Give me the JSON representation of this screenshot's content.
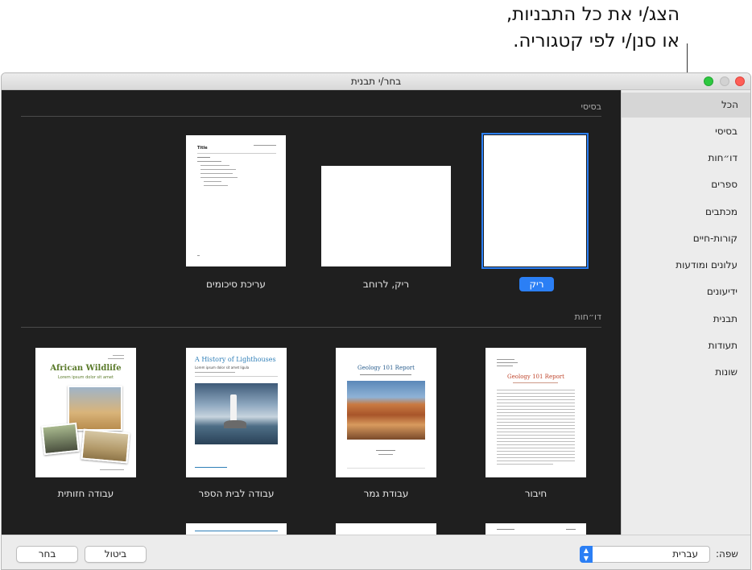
{
  "callout": {
    "line1": "הצג/י את כל התבניות,",
    "line2": "או סנן/י לפי קטגוריה."
  },
  "window": {
    "title": "בחר/י תבנית"
  },
  "sidebar": {
    "items": [
      {
        "label": "הכל"
      },
      {
        "label": "בסיסי"
      },
      {
        "label": "דו״חות"
      },
      {
        "label": "ספרים"
      },
      {
        "label": "מכתבים"
      },
      {
        "label": "קורות-חיים"
      },
      {
        "label": "עלונים ומודעות"
      },
      {
        "label": "ידיעונים"
      },
      {
        "label": "תבנית"
      },
      {
        "label": "תעודות"
      },
      {
        "label": "שונות"
      }
    ]
  },
  "sections": {
    "basic": {
      "label": "בסיסי",
      "templates": [
        {
          "caption": "ריק",
          "selected": true
        },
        {
          "caption": "ריק, לרוחב"
        },
        {
          "caption": "עריכת סיכומים",
          "thumb_title": "Title"
        }
      ]
    },
    "reports": {
      "label": "דו״חות",
      "templates": [
        {
          "caption": "חיבור",
          "thumb_title": "Geology 101 Report"
        },
        {
          "caption": "עבודת גמר",
          "thumb_title": "Geology 101 Report"
        },
        {
          "caption": "עבודה לבית הספר",
          "thumb_title": "A History of Lighthouses"
        },
        {
          "caption": "עבודה חזותית",
          "thumb_title": "African Wildlife",
          "thumb_subtitle": "Lorem ipsum dolor sit amet"
        }
      ]
    }
  },
  "thumb_text": {
    "lighthouse_subtitle": "Lorem ipsum dolor sit amet ligula"
  },
  "bottom": {
    "language_label": "שפה:",
    "language_value": "עברית",
    "cancel_label": "ביטול",
    "choose_label": "בחר"
  },
  "colors": {
    "accent": "#2b7ff5",
    "dark_bg": "#1f1f1f",
    "african_title": "#5a7a2a",
    "geology_title": "#c0482f",
    "lighthouse_title": "#2f7fb8"
  }
}
